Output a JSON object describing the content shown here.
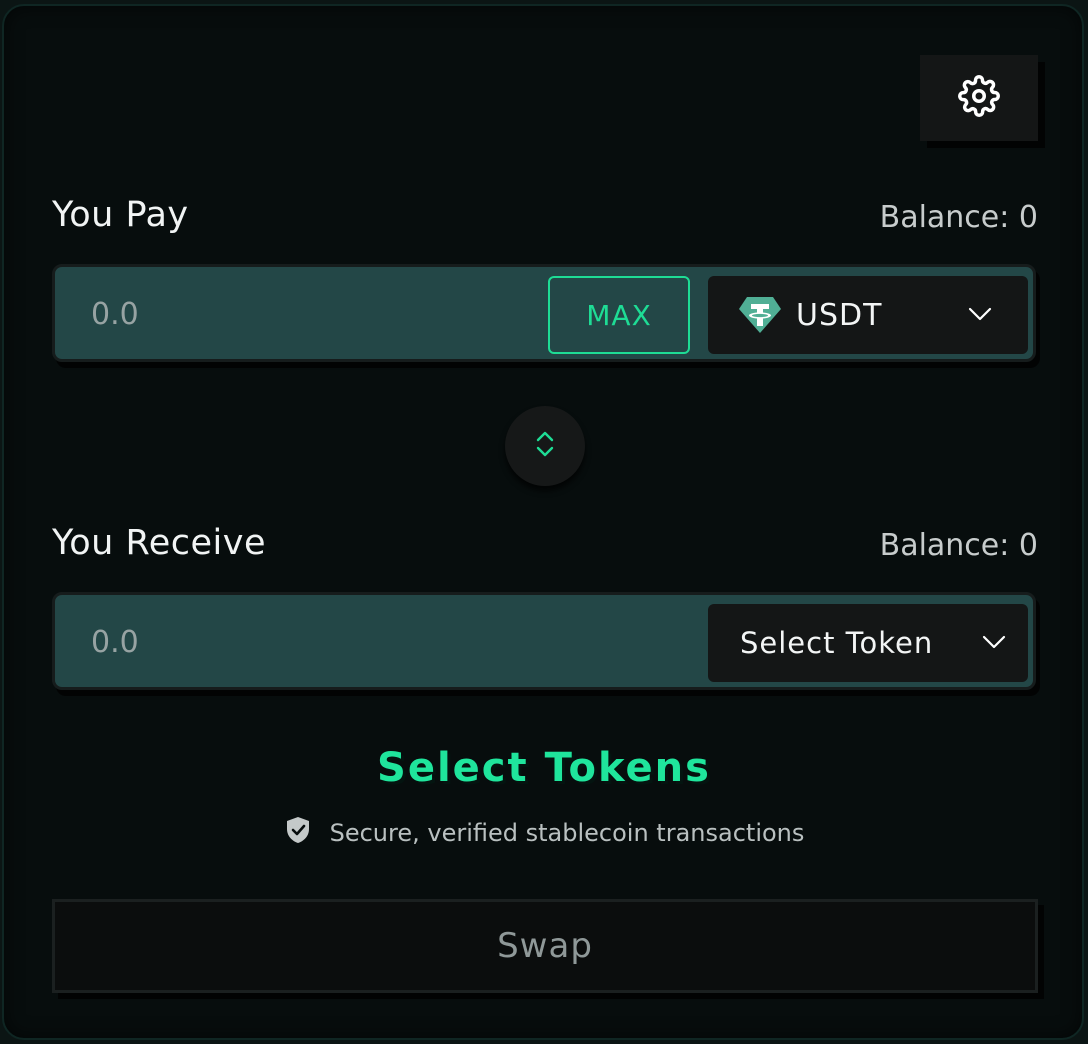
{
  "settings": {
    "icon": "gear-icon"
  },
  "pay": {
    "label": "You Pay",
    "balance": "Balance: 0",
    "amount_placeholder": "0.0",
    "max_label": "MAX",
    "token": {
      "symbol": "USDT",
      "icon": "tether-icon",
      "color": "#50af95"
    }
  },
  "switch": {
    "icon": "swap-vertical-icon",
    "color": "#1edc95"
  },
  "receive": {
    "label": "You Receive",
    "balance": "Balance: 0",
    "amount_placeholder": "0.0",
    "token_label": "Select Token"
  },
  "status": {
    "title": "Select Tokens",
    "secure_text": "Secure, verified stablecoin transactions",
    "secure_icon": "shield-check-icon"
  },
  "swap_button": {
    "label": "Swap"
  },
  "colors": {
    "accent": "#1edc95",
    "panel": "#234747",
    "background": "#070d0d"
  }
}
